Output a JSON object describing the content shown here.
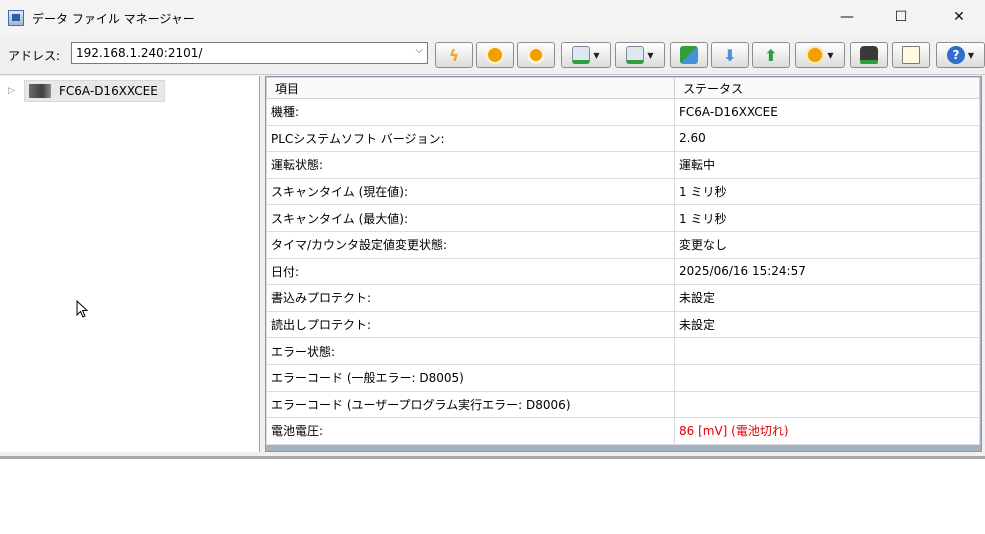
{
  "window": {
    "title": "データ ファイル マネージャー",
    "minimize": "—",
    "maximize": "☐",
    "close": "✕"
  },
  "address": {
    "label": "アドレス:",
    "value": "192.168.1.240:2101/"
  },
  "toolbar": {
    "colors": {
      "run": "#f5a623",
      "start": "#f0a000",
      "stop": "#f0a000",
      "green": "#2f9e3f",
      "blue": "#4a90d9",
      "help": "#2f6ecf"
    }
  },
  "tree": {
    "root_label": "FC6A-D16XXCEE"
  },
  "table": {
    "headers": [
      "項目",
      "ステータス"
    ],
    "rows": [
      {
        "item": "機種:",
        "status": "FC6A-D16XXCEE"
      },
      {
        "item": "PLCシステムソフト バージョン:",
        "status": "2.60"
      },
      {
        "item": "運転状態:",
        "status": "運転中"
      },
      {
        "item": "スキャンタイム (現在値):",
        "status": "1 ミリ秒"
      },
      {
        "item": "スキャンタイム (最大値):",
        "status": "1 ミリ秒"
      },
      {
        "item": "タイマ/カウンタ設定値変更状態:",
        "status": "変更なし"
      },
      {
        "item": "日付:",
        "status": "2025/06/16 15:24:57"
      },
      {
        "item": "書込みプロテクト:",
        "status": "未設定"
      },
      {
        "item": "読出しプロテクト:",
        "status": "未設定"
      },
      {
        "item": "エラー状態:",
        "status": ""
      },
      {
        "item": "エラーコード (一般エラー: D8005)",
        "status": ""
      },
      {
        "item": "エラーコード (ユーザープログラム実行エラー: D8006)",
        "status": ""
      },
      {
        "item": "電池電圧:",
        "status": "86 [mV] (電池切れ)"
      }
    ],
    "alert_color": "#e00000"
  }
}
